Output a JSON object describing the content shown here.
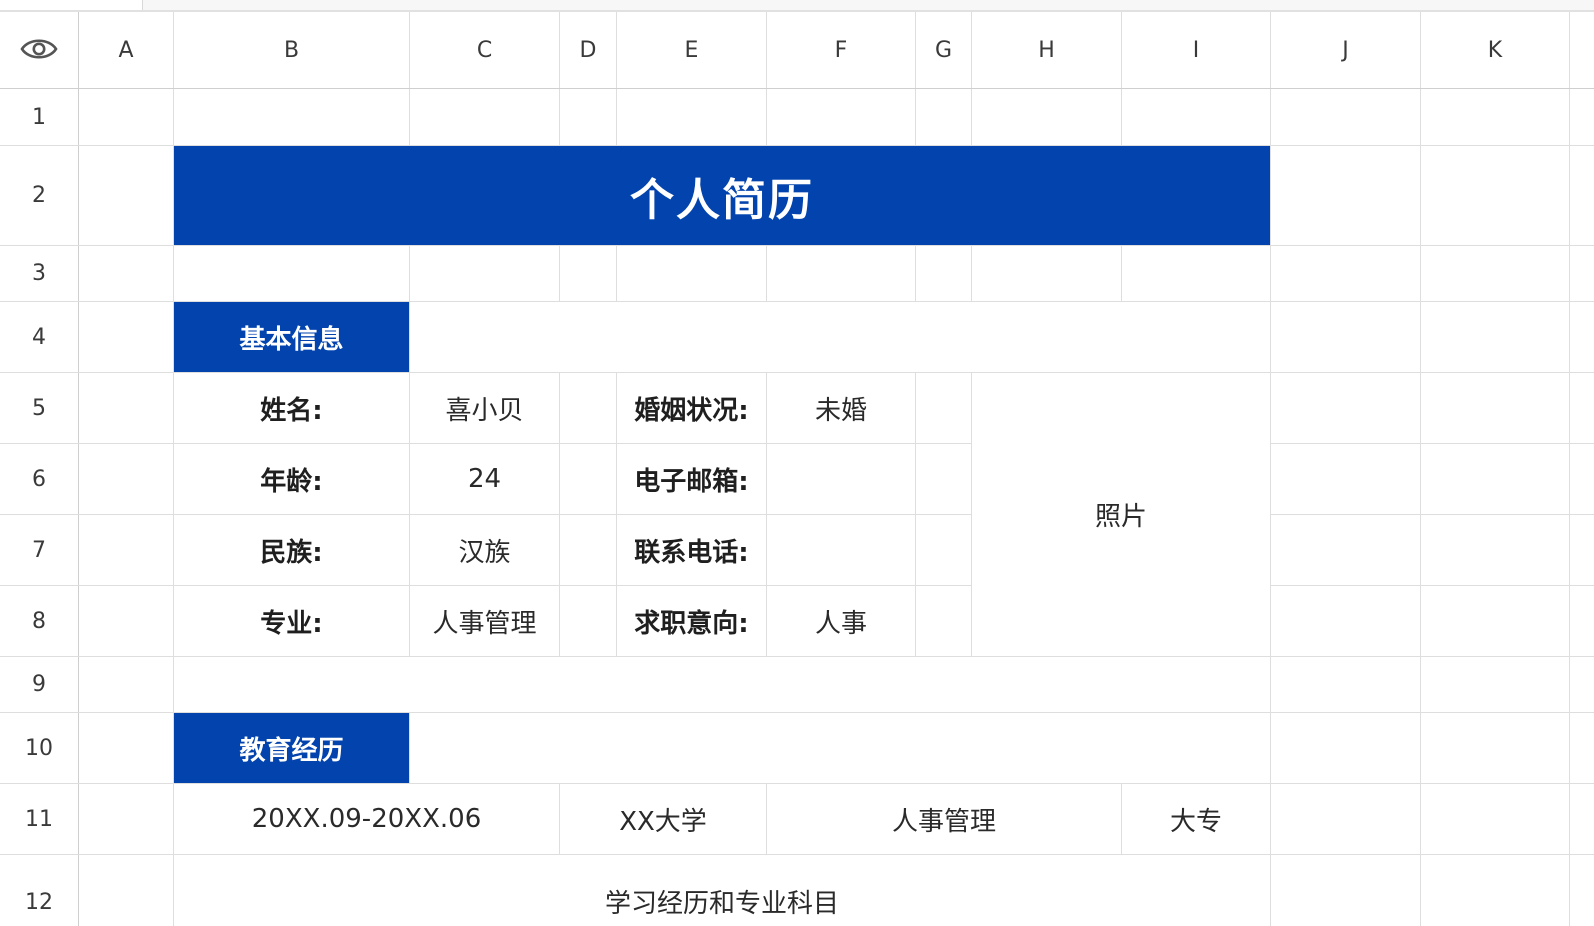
{
  "columns": [
    "A",
    "B",
    "C",
    "D",
    "E",
    "F",
    "G",
    "H",
    "I",
    "J",
    "K"
  ],
  "rows": [
    "1",
    "2",
    "3",
    "4",
    "5",
    "6",
    "7",
    "8",
    "9",
    "10",
    "11",
    "12"
  ],
  "header_icon": "eye-icon",
  "resume": {
    "title": "个人简历",
    "section_basic": "基本信息",
    "name_label": "姓名:",
    "name_value": "喜小贝",
    "marital_label": "婚姻状况:",
    "marital_value": "未婚",
    "age_label": "年龄:",
    "age_value": "24",
    "email_label": "电子邮箱:",
    "email_value": "",
    "ethnic_label": "民族:",
    "ethnic_value": "汉族",
    "phone_label": "联系电话:",
    "phone_value": "",
    "major_label": "专业:",
    "major_value": "人事管理",
    "intent_label": "求职意向:",
    "intent_value": "人事",
    "photo_label": "照片",
    "section_edu": "教育经历",
    "edu_period": "20XX.09-20XX.06",
    "edu_school": "XX大学",
    "edu_major": "人事管理",
    "edu_degree": "大专",
    "edu_detail_title": "学习经历和专业科目"
  },
  "colors": {
    "accent_blue": "#0243ad",
    "grid_line": "#dedede"
  }
}
